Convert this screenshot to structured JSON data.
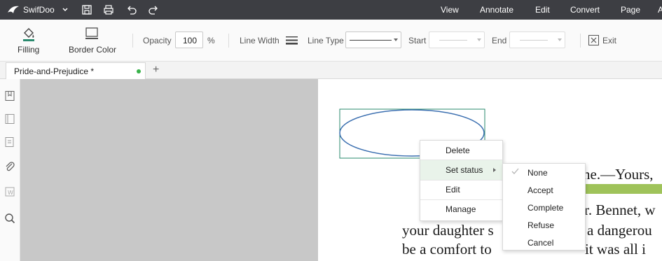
{
  "app": {
    "name": "SwifDoo"
  },
  "menu": [
    "View",
    "Annotate",
    "Edit",
    "Convert",
    "Page",
    "A"
  ],
  "ribbon": {
    "filling": "Filling",
    "border_color": "Border Color",
    "opacity_label": "Opacity",
    "opacity_value": "100",
    "opacity_unit": "%",
    "line_width": "Line Width",
    "line_type": "Line Type",
    "start": "Start",
    "end": "End",
    "exit": "Exit"
  },
  "tabs": {
    "document": "Pride-and-Prejudice *",
    "add": "+"
  },
  "page_text": {
    "line1": "ne.—Yours,",
    "line2": "r. Bennet, w",
    "line3a": "your daughter s",
    "line3b": "a dangerou",
    "line4a": "be a comfort to",
    "line4b": "it was all i"
  },
  "context_menu": {
    "items": [
      "Delete",
      "Set status",
      "Edit",
      "Manage"
    ]
  },
  "status_menu": {
    "items": [
      "None",
      "Accept",
      "Complete",
      "Refuse",
      "Cancel"
    ],
    "checked": "None"
  },
  "colors": {
    "titlebar": "#3d3e43",
    "accent": "#2a8a6e",
    "highlight": "#9fc35a",
    "ellipse": "#3b6fb0"
  }
}
